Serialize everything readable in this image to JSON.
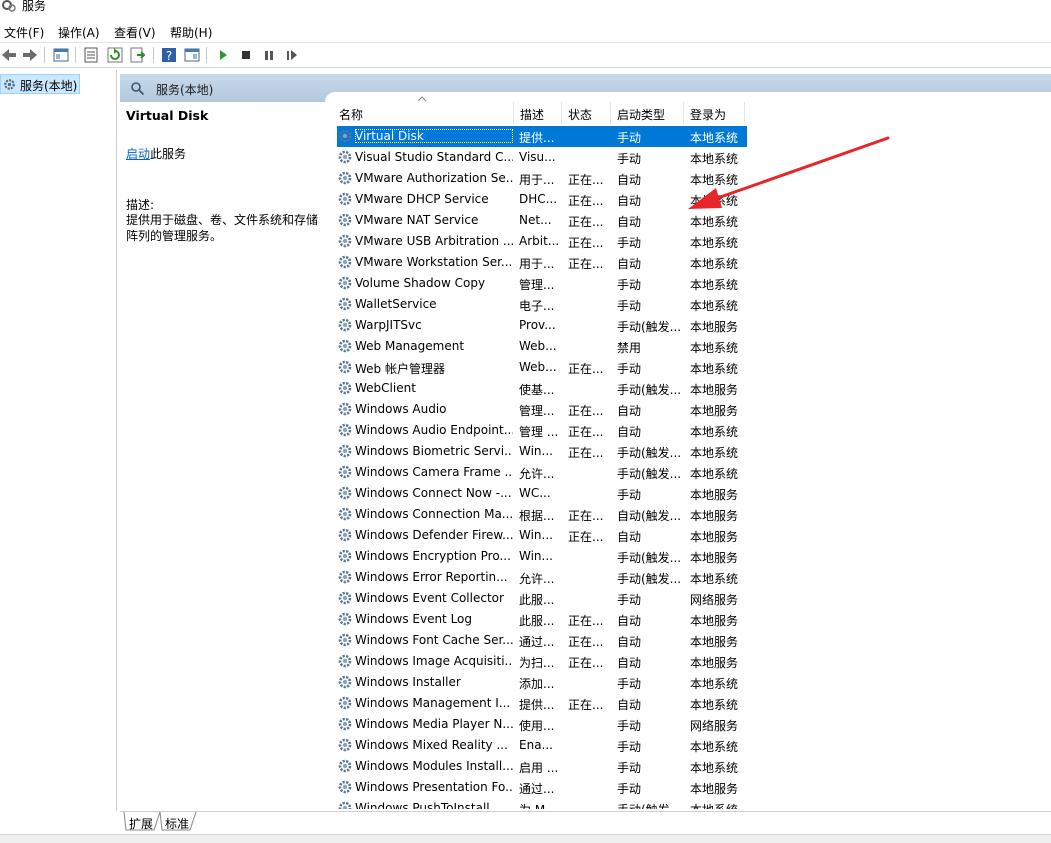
{
  "window": {
    "title": "服务"
  },
  "menu": [
    "文件(F)",
    "操作(A)",
    "查看(V)",
    "帮助(H)"
  ],
  "toolbar": [
    "back-icon",
    "forward-icon",
    "show-hide-tree-icon",
    "properties-icon",
    "refresh-icon",
    "export-icon",
    "help-icon",
    "show-console-icon",
    "start-icon",
    "stop-icon",
    "pause-icon",
    "restart-icon"
  ],
  "tree": {
    "item": "服务(本地)"
  },
  "band": {
    "title": "服务(本地)"
  },
  "detail": {
    "title": "Virtual Disk",
    "action_link": "启动",
    "action_suffix": "此服务",
    "desc_label": "描述:",
    "description": "提供用于磁盘、卷、文件系统和存储阵列的管理服务。"
  },
  "columns": {
    "name": "名称",
    "desc": "描述",
    "status": "状态",
    "type": "启动类型",
    "logon": "登录为"
  },
  "services": [
    {
      "name": "Virtual Disk",
      "desc": "提供...",
      "status": "",
      "type": "手动",
      "logon": "本地系统"
    },
    {
      "name": "Visual Studio Standard C...",
      "desc": "Visu...",
      "status": "",
      "type": "手动",
      "logon": "本地系统"
    },
    {
      "name": "VMware Authorization Se...",
      "desc": "用于...",
      "status": "正在...",
      "type": "自动",
      "logon": "本地系统"
    },
    {
      "name": "VMware DHCP Service",
      "desc": "DHC...",
      "status": "正在...",
      "type": "自动",
      "logon": "本地系统"
    },
    {
      "name": "VMware NAT Service",
      "desc": "Net...",
      "status": "正在...",
      "type": "自动",
      "logon": "本地系统"
    },
    {
      "name": "VMware USB Arbitration ...",
      "desc": "Arbit...",
      "status": "正在...",
      "type": "手动",
      "logon": "本地系统"
    },
    {
      "name": "VMware Workstation Ser...",
      "desc": "用于...",
      "status": "正在...",
      "type": "自动",
      "logon": "本地系统"
    },
    {
      "name": "Volume Shadow Copy",
      "desc": "管理...",
      "status": "",
      "type": "手动",
      "logon": "本地系统"
    },
    {
      "name": "WalletService",
      "desc": "电子...",
      "status": "",
      "type": "手动",
      "logon": "本地系统"
    },
    {
      "name": "WarpJITSvc",
      "desc": "Prov...",
      "status": "",
      "type": "手动(触发...",
      "logon": "本地服务"
    },
    {
      "name": "Web Management",
      "desc": "Web...",
      "status": "",
      "type": "禁用",
      "logon": "本地系统"
    },
    {
      "name": "Web 帐户管理器",
      "desc": "Web...",
      "status": "正在...",
      "type": "手动",
      "logon": "本地系统"
    },
    {
      "name": "WebClient",
      "desc": "使基...",
      "status": "",
      "type": "手动(触发...",
      "logon": "本地服务"
    },
    {
      "name": "Windows Audio",
      "desc": "管理...",
      "status": "正在...",
      "type": "自动",
      "logon": "本地服务"
    },
    {
      "name": "Windows Audio Endpoint...",
      "desc": "管理 ...",
      "status": "正在...",
      "type": "自动",
      "logon": "本地系统"
    },
    {
      "name": "Windows Biometric Servi...",
      "desc": "Win...",
      "status": "正在...",
      "type": "手动(触发...",
      "logon": "本地系统"
    },
    {
      "name": "Windows Camera Frame ...",
      "desc": "允许...",
      "status": "",
      "type": "手动(触发...",
      "logon": "本地系统"
    },
    {
      "name": "Windows Connect Now -...",
      "desc": "WC...",
      "status": "",
      "type": "手动",
      "logon": "本地服务"
    },
    {
      "name": "Windows Connection Ma...",
      "desc": "根据...",
      "status": "正在...",
      "type": "自动(触发...",
      "logon": "本地服务"
    },
    {
      "name": "Windows Defender Firew...",
      "desc": "Win...",
      "status": "正在...",
      "type": "自动",
      "logon": "本地服务"
    },
    {
      "name": "Windows Encryption Pro...",
      "desc": "Win...",
      "status": "",
      "type": "手动(触发...",
      "logon": "本地服务"
    },
    {
      "name": "Windows Error Reportin...",
      "desc": "允许...",
      "status": "",
      "type": "手动(触发...",
      "logon": "本地系统"
    },
    {
      "name": "Windows Event Collector",
      "desc": "此服...",
      "status": "",
      "type": "手动",
      "logon": "网络服务"
    },
    {
      "name": "Windows Event Log",
      "desc": "此服...",
      "status": "正在...",
      "type": "自动",
      "logon": "本地服务"
    },
    {
      "name": "Windows Font Cache Ser...",
      "desc": "通过...",
      "status": "正在...",
      "type": "自动",
      "logon": "本地服务"
    },
    {
      "name": "Windows Image Acquisiti...",
      "desc": "为扫...",
      "status": "正在...",
      "type": "自动",
      "logon": "本地服务"
    },
    {
      "name": "Windows Installer",
      "desc": "添加...",
      "status": "",
      "type": "手动",
      "logon": "本地系统"
    },
    {
      "name": "Windows Management I...",
      "desc": "提供...",
      "status": "正在...",
      "type": "自动",
      "logon": "本地系统"
    },
    {
      "name": "Windows Media Player N...",
      "desc": "使用...",
      "status": "",
      "type": "手动",
      "logon": "网络服务"
    },
    {
      "name": "Windows Mixed Reality ...",
      "desc": "Ena...",
      "status": "",
      "type": "手动",
      "logon": "本地系统"
    },
    {
      "name": "Windows Modules Install...",
      "desc": "启用 ...",
      "status": "",
      "type": "手动",
      "logon": "本地系统"
    },
    {
      "name": "Windows Presentation Fo...",
      "desc": "通过...",
      "status": "",
      "type": "手动",
      "logon": "本地服务"
    },
    {
      "name": "Windows PushToInstall ...",
      "desc": "为 M...",
      "status": "",
      "type": "手动(触发...",
      "logon": "本地系统"
    }
  ],
  "tabs": [
    "扩展",
    "标准"
  ],
  "colors": {
    "selection": "#0078d7",
    "link": "#0066cc",
    "arrow": "#e8262a",
    "band": "#c8d9ea"
  }
}
